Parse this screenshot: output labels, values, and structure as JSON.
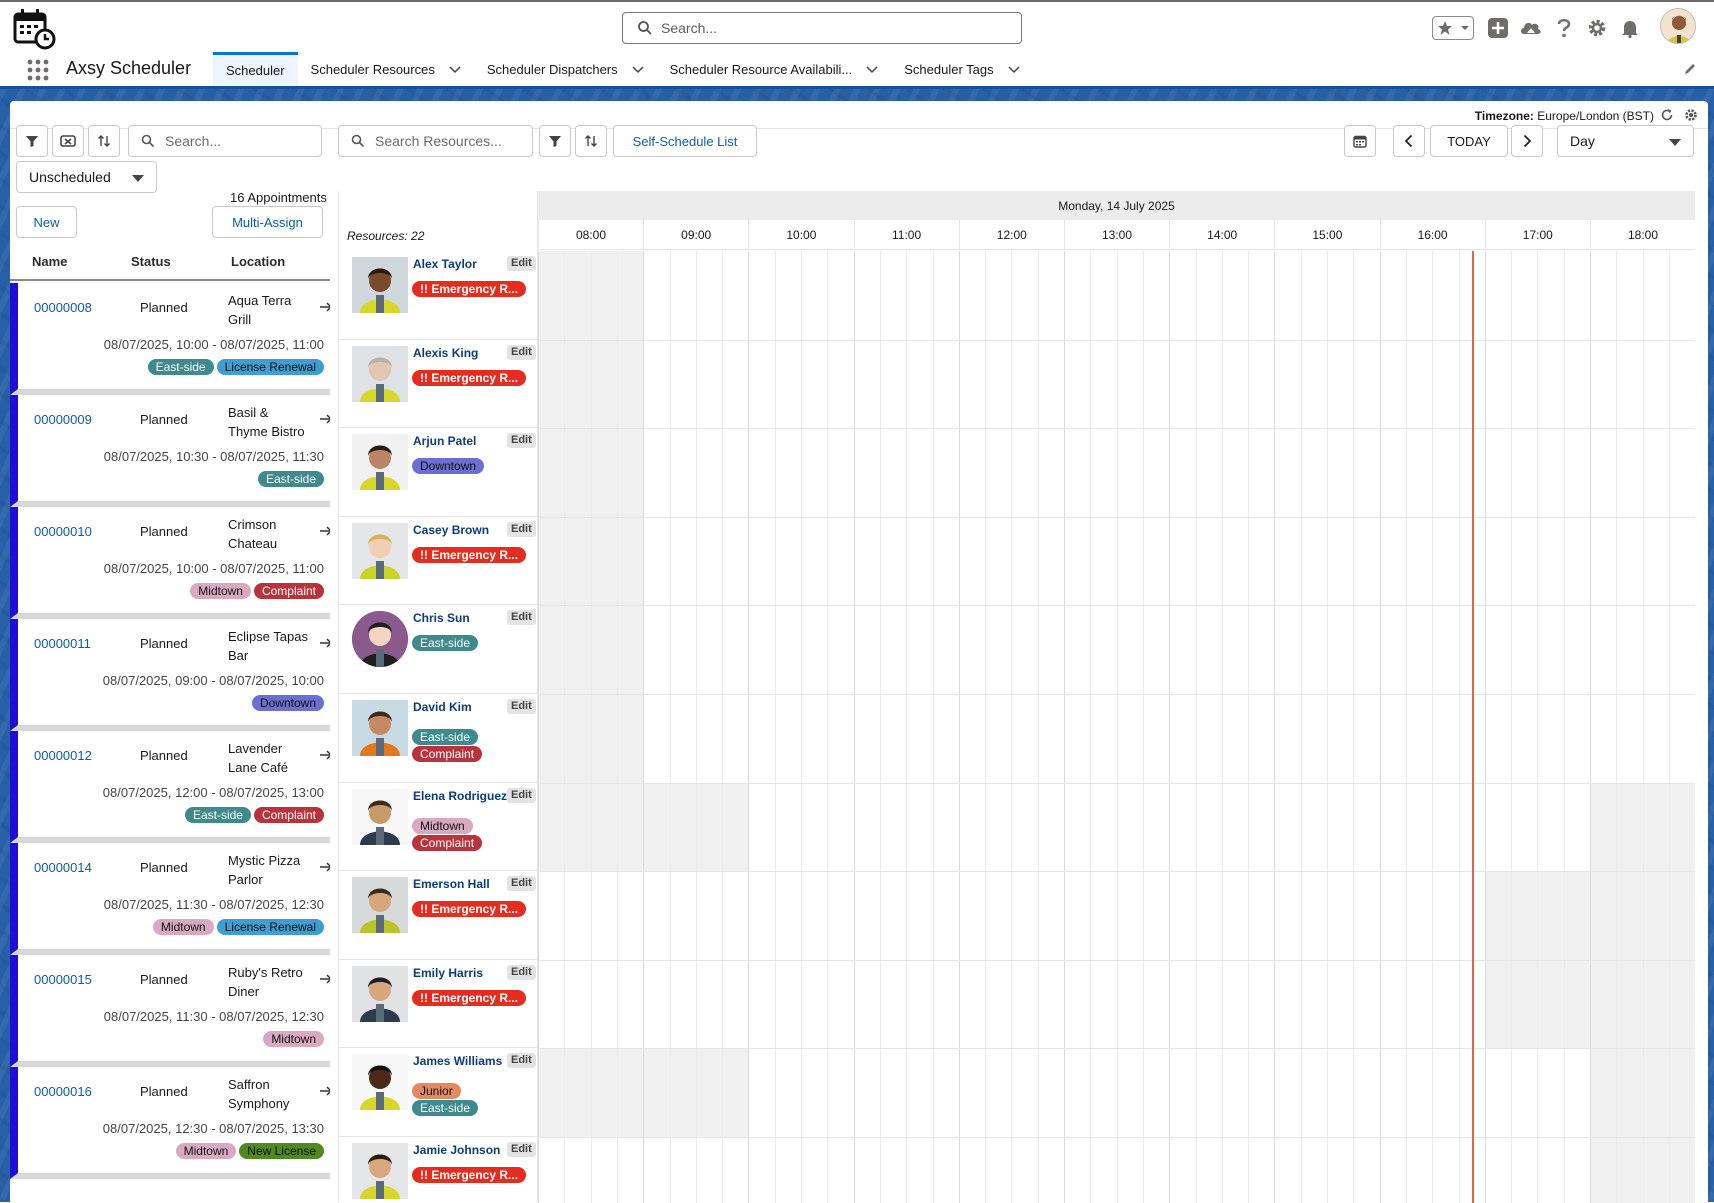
{
  "header": {
    "search_placeholder": "Search..."
  },
  "nav": {
    "app_name": "Axsy Scheduler",
    "tabs": [
      {
        "label": "Scheduler",
        "active": true,
        "has_menu": false
      },
      {
        "label": "Scheduler Resources",
        "active": false,
        "has_menu": true
      },
      {
        "label": "Scheduler Dispatchers",
        "active": false,
        "has_menu": true
      },
      {
        "label": "Scheduler Resource Availabili...",
        "active": false,
        "has_menu": true
      },
      {
        "label": "Scheduler Tags",
        "active": false,
        "has_menu": true
      }
    ]
  },
  "timezone": {
    "label": "Timezone:",
    "value": "Europe/London (BST)"
  },
  "left_panel": {
    "search_placeholder": "Search...",
    "filter_value": "Unscheduled",
    "appointment_count": "16 Appointments",
    "new_label": "New",
    "multi_assign_label": "Multi-Assign",
    "columns": [
      "Name",
      "Status",
      "Location"
    ],
    "appointments": [
      {
        "id": "00000008",
        "status": "Planned",
        "location": "Aqua Terra Grill",
        "time": "08/07/2025, 10:00 - 08/07/2025, 11:00",
        "tags": [
          "East-side",
          "License Renewal"
        ]
      },
      {
        "id": "00000009",
        "status": "Planned",
        "location": "Basil & Thyme Bistro",
        "time": "08/07/2025, 10:30 - 08/07/2025, 11:30",
        "tags": [
          "East-side"
        ]
      },
      {
        "id": "00000010",
        "status": "Planned",
        "location": "Crimson Chateau",
        "time": "08/07/2025, 10:00 - 08/07/2025, 11:00",
        "tags": [
          "Midtown",
          "Complaint"
        ]
      },
      {
        "id": "00000011",
        "status": "Planned",
        "location": "Eclipse Tapas Bar",
        "time": "08/07/2025, 09:00 - 08/07/2025, 10:00",
        "tags": [
          "Downtown"
        ]
      },
      {
        "id": "00000012",
        "status": "Planned",
        "location": "Lavender Lane Café",
        "time": "08/07/2025, 12:00 - 08/07/2025, 13:00",
        "tags": [
          "East-side",
          "Complaint"
        ]
      },
      {
        "id": "00000014",
        "status": "Planned",
        "location": "Mystic Pizza Parlor",
        "time": "08/07/2025, 11:30 - 08/07/2025, 12:30",
        "tags": [
          "Midtown",
          "License Renewal"
        ]
      },
      {
        "id": "00000015",
        "status": "Planned",
        "location": "Ruby's Retro Diner",
        "time": "08/07/2025, 11:30 - 08/07/2025, 12:30",
        "tags": [
          "Midtown"
        ]
      },
      {
        "id": "00000016",
        "status": "Planned",
        "location": "Saffron Symphony",
        "time": "08/07/2025, 12:30 - 08/07/2025, 13:30",
        "tags": [
          "Midtown",
          "New License"
        ]
      }
    ]
  },
  "toolbar": {
    "search_resources_placeholder": "Search Resources...",
    "self_schedule_label": "Self-Schedule List",
    "today_label": "TODAY",
    "view_value": "Day"
  },
  "schedule": {
    "date_label": "Monday, 14 July 2025",
    "resources_label": "Resources: 22",
    "hours": [
      "08:00",
      "09:00",
      "10:00",
      "11:00",
      "12:00",
      "13:00",
      "14:00",
      "15:00",
      "16:00",
      "17:00",
      "18:00"
    ],
    "edit_label": "Edit",
    "resources": [
      {
        "name": "Alex Taylor",
        "tags": [
          "!! Emergency R..."
        ]
      },
      {
        "name": "Alexis King",
        "tags": [
          "!! Emergency R..."
        ]
      },
      {
        "name": "Arjun Patel",
        "tags": [
          "Downtown"
        ]
      },
      {
        "name": "Casey Brown",
        "tags": [
          "!! Emergency R..."
        ]
      },
      {
        "name": "Chris Sun",
        "tags": [
          "East-side"
        ]
      },
      {
        "name": "David Kim",
        "tags": [
          "East-side",
          "Complaint"
        ]
      },
      {
        "name": "Elena Rodriguez",
        "tags": [
          "Midtown",
          "Complaint"
        ]
      },
      {
        "name": "Emerson Hall",
        "tags": [
          "!! Emergency R..."
        ]
      },
      {
        "name": "Emily Harris",
        "tags": [
          "!! Emergency R..."
        ]
      },
      {
        "name": "James Williams",
        "tags": [
          "Junior",
          "East-side"
        ]
      },
      {
        "name": "Jamie Johnson",
        "tags": [
          "!! Emergency R..."
        ]
      }
    ]
  },
  "colors": {
    "brand": "#0176d3",
    "appointment_bar": "#1f0fd6",
    "now_line": "#e2614f"
  }
}
